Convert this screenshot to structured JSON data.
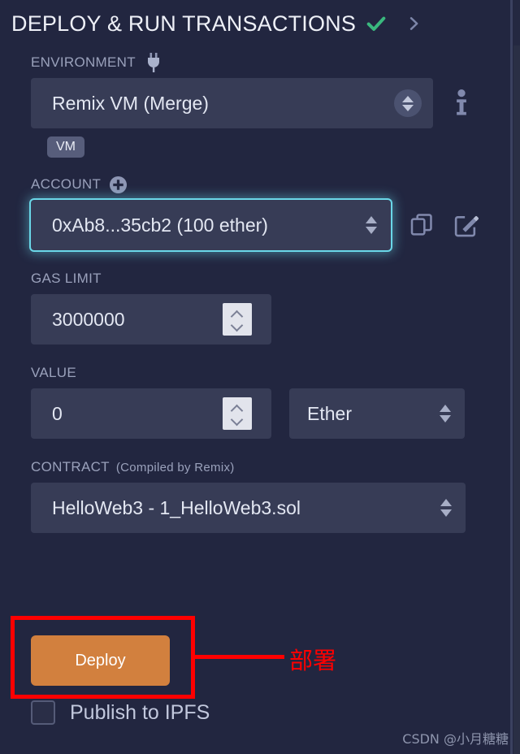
{
  "header": {
    "title": "DEPLOY & RUN TRANSACTIONS",
    "status_icon": "check-icon",
    "expand_icon": "chevron-right-icon",
    "check_color": "#3ab87e",
    "chevron_color": "#7c85a8"
  },
  "environment": {
    "label": "ENVIRONMENT",
    "icon": "plug-icon",
    "value": "Remix VM (Merge)",
    "info_icon": "info-icon",
    "badge": "VM"
  },
  "account": {
    "label": "ACCOUNT",
    "add_icon": "plus-circle-icon",
    "value": "0xAb8...35cb2 (100 ether)",
    "copy_icon": "copy-icon",
    "edit_icon": "edit-icon",
    "focus_color": "#6ad7e8"
  },
  "gas_limit": {
    "label": "GAS LIMIT",
    "value": "3000000"
  },
  "value_field": {
    "label": "VALUE",
    "value": "0",
    "unit": "Ether"
  },
  "contract": {
    "label": "CONTRACT",
    "sub_label": "(Compiled by Remix)",
    "value": "HelloWeb3 - 1_HelloWeb3.sol"
  },
  "deploy": {
    "button_label": "Deploy",
    "button_color": "#d2803e",
    "annotation_color": "#ff0000",
    "annotation_text": "部署"
  },
  "ipfs": {
    "label": "Publish to IPFS",
    "checked": false
  },
  "watermark": {
    "text": "CSDN @小月糖糖"
  }
}
